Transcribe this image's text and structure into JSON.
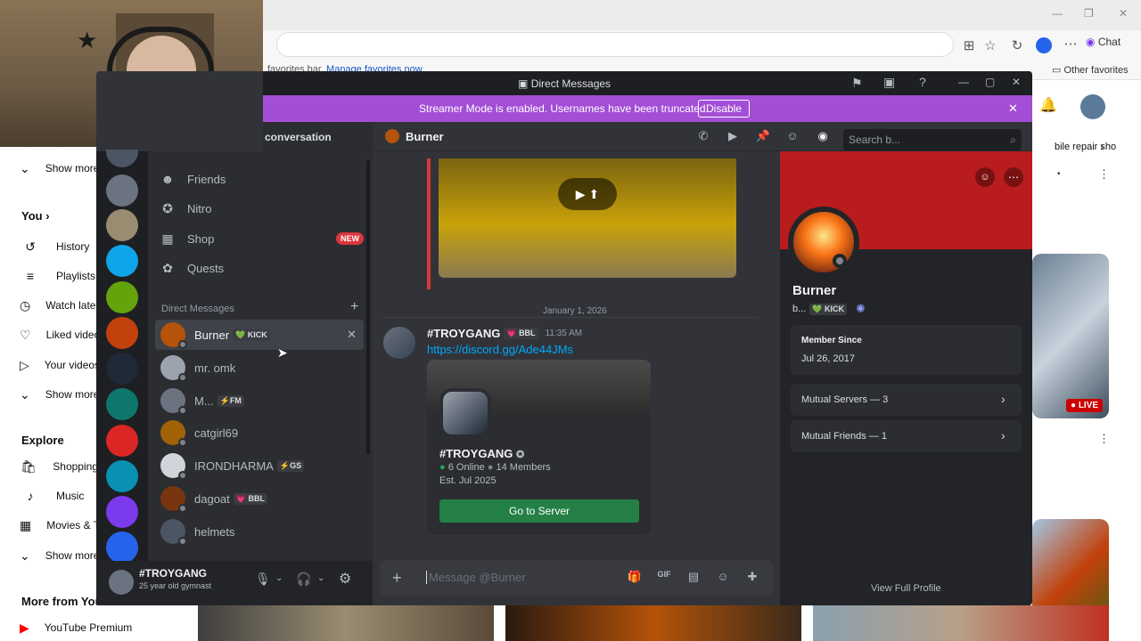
{
  "browser": {
    "favorites_note": "favorites bar.",
    "manage_favorites": "Manage favorites now",
    "chat_label": "Chat",
    "other_favorites": "Other favorites"
  },
  "youtube": {
    "sidebar": [
      {
        "label": "Show more",
        "icon": "chevron-down-icon"
      },
      {
        "label": "History",
        "icon": "history-icon"
      },
      {
        "label": "Playlists",
        "icon": "playlists-icon"
      },
      {
        "label": "Watch later",
        "icon": "clock-icon"
      },
      {
        "label": "Liked videos",
        "icon": "thumbs-up-icon"
      },
      {
        "label": "Your videos",
        "icon": "your-videos-icon"
      },
      {
        "label": "Show more",
        "icon": "chevron-down-icon"
      },
      {
        "label": "Shopping",
        "icon": "shopping-bag-icon"
      },
      {
        "label": "Music",
        "icon": "music-icon"
      },
      {
        "label": "Movies & TV",
        "icon": "movies-icon"
      },
      {
        "label": "Show more",
        "icon": "chevron-down-icon"
      },
      {
        "label": "YouTube Premium",
        "icon": "youtube-premium-icon"
      }
    ],
    "you_heading": "You",
    "explore_heading": "Explore",
    "more_heading": "More from YouTube",
    "right_snippet": "bile repair sho",
    "live_label": "LIVE"
  },
  "discord": {
    "window_title": "Direct Messages",
    "streamer_notice": "Streamer Mode is enabled. Usernames have been truncated.",
    "disable_label": "Disable",
    "find_conversation": "conversation",
    "nav": [
      {
        "label": "Friends",
        "icon": "friends-icon"
      },
      {
        "label": "Nitro",
        "icon": "nitro-icon"
      },
      {
        "label": "Shop",
        "icon": "shop-icon",
        "badge": "NEW"
      },
      {
        "label": "Quests",
        "icon": "quests-icon"
      }
    ],
    "dm_heading": "Direct Messages",
    "dms": [
      {
        "name": "Burner",
        "tag": "KICK",
        "color": "#b45309"
      },
      {
        "name": "mr. omk",
        "tag": "",
        "color": "#9ca3af"
      },
      {
        "name": "M...",
        "tag": "FM",
        "color": "#6b7280"
      },
      {
        "name": "catgirl69",
        "tag": "",
        "color": "#a16207"
      },
      {
        "name": "IRONDHARMA",
        "tag": "GS",
        "color": "#d1d5db"
      },
      {
        "name": "dagoat",
        "tag": "BBL",
        "color": "#78350f"
      },
      {
        "name": "helmets",
        "tag": "",
        "color": "#4b5563"
      }
    ],
    "user": {
      "name": "#TROYGANG",
      "status": "25 year old gymnast"
    },
    "chat": {
      "recipient": "Burner",
      "search_placeholder": "Search b...",
      "date_divider": "January 1, 2026",
      "author": "#TROYGANG",
      "author_tag": "BBL",
      "time": "11:35 AM",
      "link": "https://discord.gg/Ade44JMs",
      "invite": {
        "server_name": "#TROYGANG",
        "online": "6 Online",
        "members": "14 Members",
        "established": "Est. Jul 2025",
        "button": "Go to Server"
      },
      "message_placeholder": "Message @Burner"
    },
    "profile": {
      "name": "Burner",
      "handle": "b...",
      "tag": "KICK",
      "member_since_label": "Member Since",
      "member_since": "Jul 26, 2017",
      "mutual_servers": "Mutual Servers — 3",
      "mutual_friends": "Mutual Friends — 1",
      "view_full": "View Full Profile"
    },
    "colors": {
      "streamer_bar": "#a34ed6",
      "banner": "#b91c1c",
      "go_button": "#248046",
      "new_badge": "#da373c"
    }
  }
}
